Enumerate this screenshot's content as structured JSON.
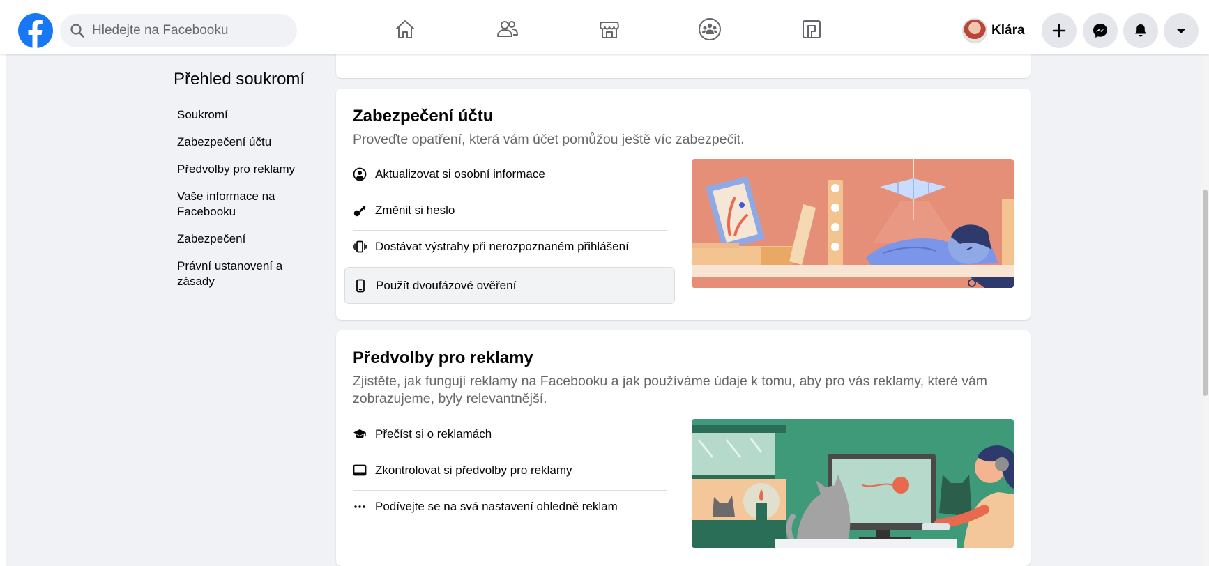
{
  "header": {
    "search_placeholder": "Hledejte na Facebooku",
    "user_name": "Klára"
  },
  "sidebar": {
    "title": "Přehled soukromí",
    "items": [
      {
        "label": "Soukromí"
      },
      {
        "label": "Zabezpečení účtu"
      },
      {
        "label": "Předvolby pro reklamy"
      },
      {
        "label": "Vaše informace na Facebooku"
      },
      {
        "label": "Zabezpečení"
      },
      {
        "label": "Právní ustanovení a zásady"
      }
    ]
  },
  "security_card": {
    "title": "Zabezpečení účtu",
    "description": "Proveďte opatření, která vám účet pomůžou ještě víc zabezpečit.",
    "options": [
      {
        "label": "Aktualizovat si osobní informace",
        "icon": "user-circle-icon"
      },
      {
        "label": "Změnit si heslo",
        "icon": "key-icon"
      },
      {
        "label": "Dostávat výstrahy při nerozpoznaném přihlášení",
        "icon": "phone-vibrate-icon"
      },
      {
        "label": "Použít dvoufázové ověření",
        "icon": "phone-icon"
      }
    ]
  },
  "ads_card": {
    "title": "Předvolby pro reklamy",
    "description": "Zjistěte, jak fungují reklamy na Facebooku a jak používáme údaje k tomu, aby pro vás reklamy, které vám zobrazujeme, byly relevantnější.",
    "options": [
      {
        "label": "Přečíst si o reklamách",
        "icon": "graduation-cap-icon"
      },
      {
        "label": "Zkontrolovat si předvolby pro reklamy",
        "icon": "laptop-icon"
      },
      {
        "label": "Podívejte se na svá nastavení ohledně reklam",
        "icon": "more-dots-icon"
      }
    ]
  },
  "colors": {
    "brand": "#1877f2",
    "page_bg": "#f0f2f5",
    "secondary_text": "#65676b"
  }
}
